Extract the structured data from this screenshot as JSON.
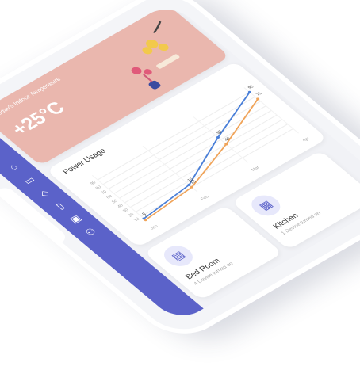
{
  "sidebar": {
    "menu_icon": "hamburger-icon",
    "items": [
      {
        "icon": "cube-icon",
        "glyph": "⬡"
      },
      {
        "icon": "home-icon",
        "glyph": "⌂"
      },
      {
        "icon": "monitor-icon",
        "glyph": "▭"
      },
      {
        "icon": "shield-icon",
        "glyph": "◇"
      },
      {
        "icon": "door-icon",
        "glyph": "▯"
      },
      {
        "icon": "device-icon",
        "glyph": "▣"
      },
      {
        "icon": "users-icon",
        "glyph": "⚇"
      }
    ]
  },
  "temperature": {
    "label": "Today's Indoor Temperature",
    "value": "+25°C"
  },
  "power": {
    "title": "Power Usage",
    "chart_data": {
      "type": "line",
      "categories": [
        "Jan",
        "Feb",
        "Mar",
        "Apr"
      ],
      "ylim": [
        0,
        100
      ],
      "yticks": [
        10,
        20,
        30,
        40,
        50,
        60,
        70,
        80,
        90
      ],
      "series": [
        {
          "values": [
            5,
            15,
            55,
            90
          ],
          "color": "#4a7fd8",
          "labels": [
            "5",
            "15",
            "55",
            "90"
          ]
        },
        {
          "values": [
            2,
            10,
            40,
            75
          ],
          "color": "#f0a45a",
          "labels": [
            "2",
            "10",
            "40",
            "75"
          ]
        }
      ]
    }
  },
  "rooms": [
    {
      "name": "Bed Room",
      "status": "4 Device turned on",
      "icon": "bed-icon"
    },
    {
      "name": "Kitchen",
      "status": "1 Device turned on",
      "icon": "kitchen-icon"
    }
  ]
}
